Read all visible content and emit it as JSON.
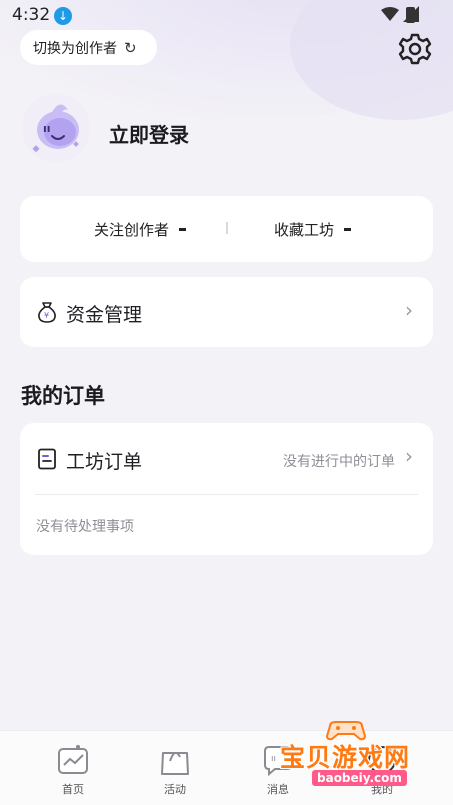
{
  "status_bar": {
    "time": "4:32"
  },
  "header": {
    "switch_label": "切换为创作者"
  },
  "profile": {
    "login_label": "立即登录"
  },
  "stats": {
    "following_label": "关注创作者",
    "following_value": "",
    "favorites_label": "收藏工坊",
    "favorites_value": ""
  },
  "funds": {
    "label": "资金管理"
  },
  "orders": {
    "section_title": "我的订单",
    "workshop_label": "工坊订单",
    "workshop_status": "没有进行中的订单",
    "pending_text": "没有待处理事项"
  },
  "bottom_nav": [
    {
      "label": "首页"
    },
    {
      "label": "活动"
    },
    {
      "label": "消息"
    },
    {
      "label": "我的"
    }
  ],
  "watermark": {
    "title": "宝贝游戏网",
    "url": "baobeiy.com"
  },
  "colors": {
    "accent_purple": "#b9a8f0",
    "background": "#f3f2f6",
    "watermark_orange": "#ff7a12"
  }
}
